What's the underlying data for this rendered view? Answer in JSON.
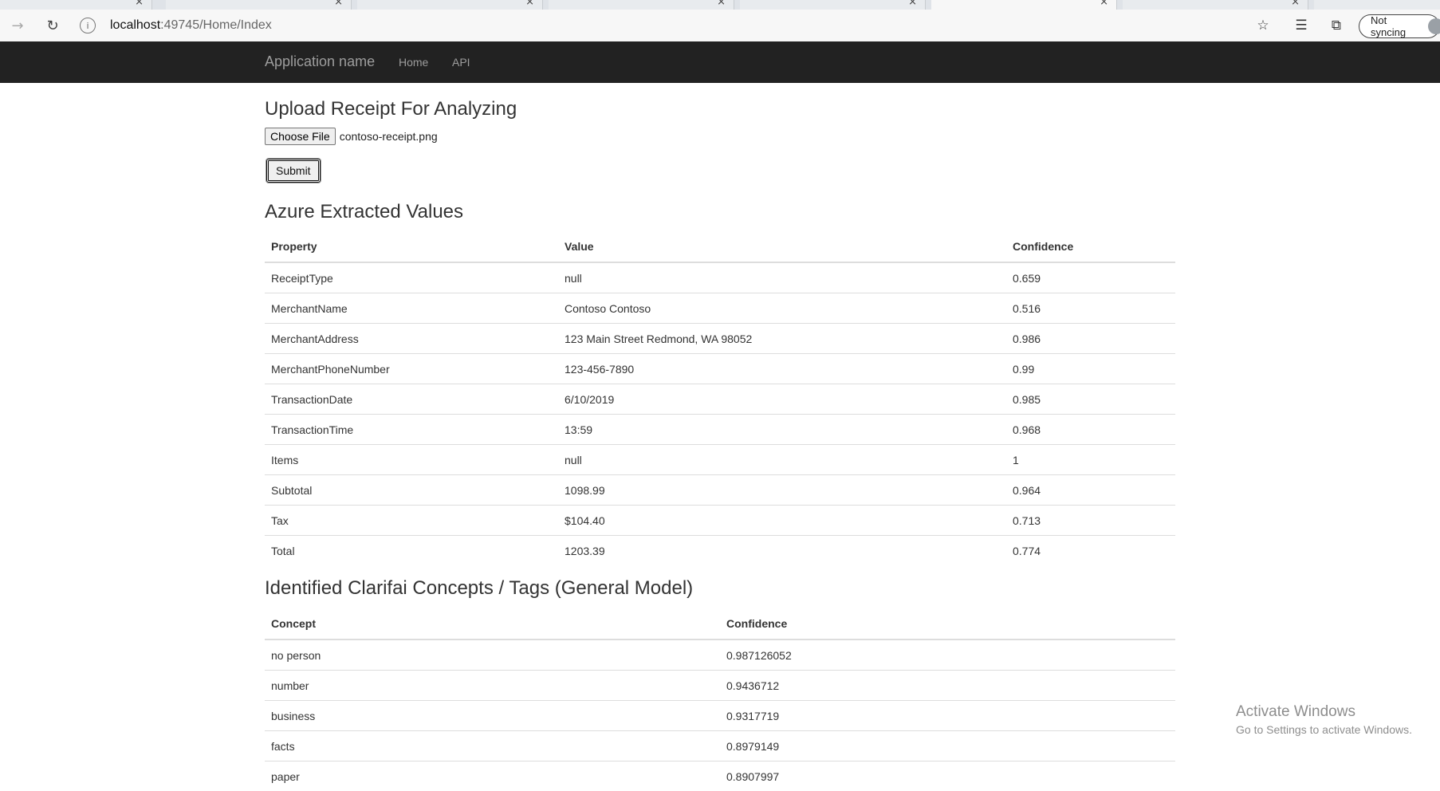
{
  "browser": {
    "url_host": "localhost",
    "url_path": ":49745/Home/Index",
    "sync_label": "Not syncing"
  },
  "navbar": {
    "brand": "Application name",
    "links": [
      "Home",
      "API"
    ]
  },
  "upload": {
    "heading": "Upload Receipt For Analyzing",
    "choose_label": "Choose File",
    "file_name": "contoso-receipt.png",
    "submit_label": "Submit"
  },
  "azure": {
    "heading": "Azure Extracted Values",
    "headers": [
      "Property",
      "Value",
      "Confidence"
    ],
    "rows": [
      [
        "ReceiptType",
        "null",
        "0.659"
      ],
      [
        "MerchantName",
        "Contoso Contoso",
        "0.516"
      ],
      [
        "MerchantAddress",
        "123 Main Street Redmond, WA 98052",
        "0.986"
      ],
      [
        "MerchantPhoneNumber",
        "123-456-7890",
        "0.99"
      ],
      [
        "TransactionDate",
        "6/10/2019",
        "0.985"
      ],
      [
        "TransactionTime",
        "13:59",
        "0.968"
      ],
      [
        "Items",
        "null",
        "1"
      ],
      [
        "Subtotal",
        "1098.99",
        "0.964"
      ],
      [
        "Tax",
        "$104.40",
        "0.713"
      ],
      [
        "Total",
        "1203.39",
        "0.774"
      ]
    ]
  },
  "clarifai": {
    "heading": "Identified Clarifai Concepts / Tags (General Model)",
    "headers": [
      "Concept",
      "Confidence"
    ],
    "rows": [
      [
        "no person",
        "0.987126052"
      ],
      [
        "number",
        "0.9436712"
      ],
      [
        "business",
        "0.9317719"
      ],
      [
        "facts",
        "0.8979149"
      ],
      [
        "paper",
        "0.8907997"
      ]
    ]
  },
  "watermark": {
    "line1": "Activate Windows",
    "line2": "Go to Settings to activate Windows."
  }
}
